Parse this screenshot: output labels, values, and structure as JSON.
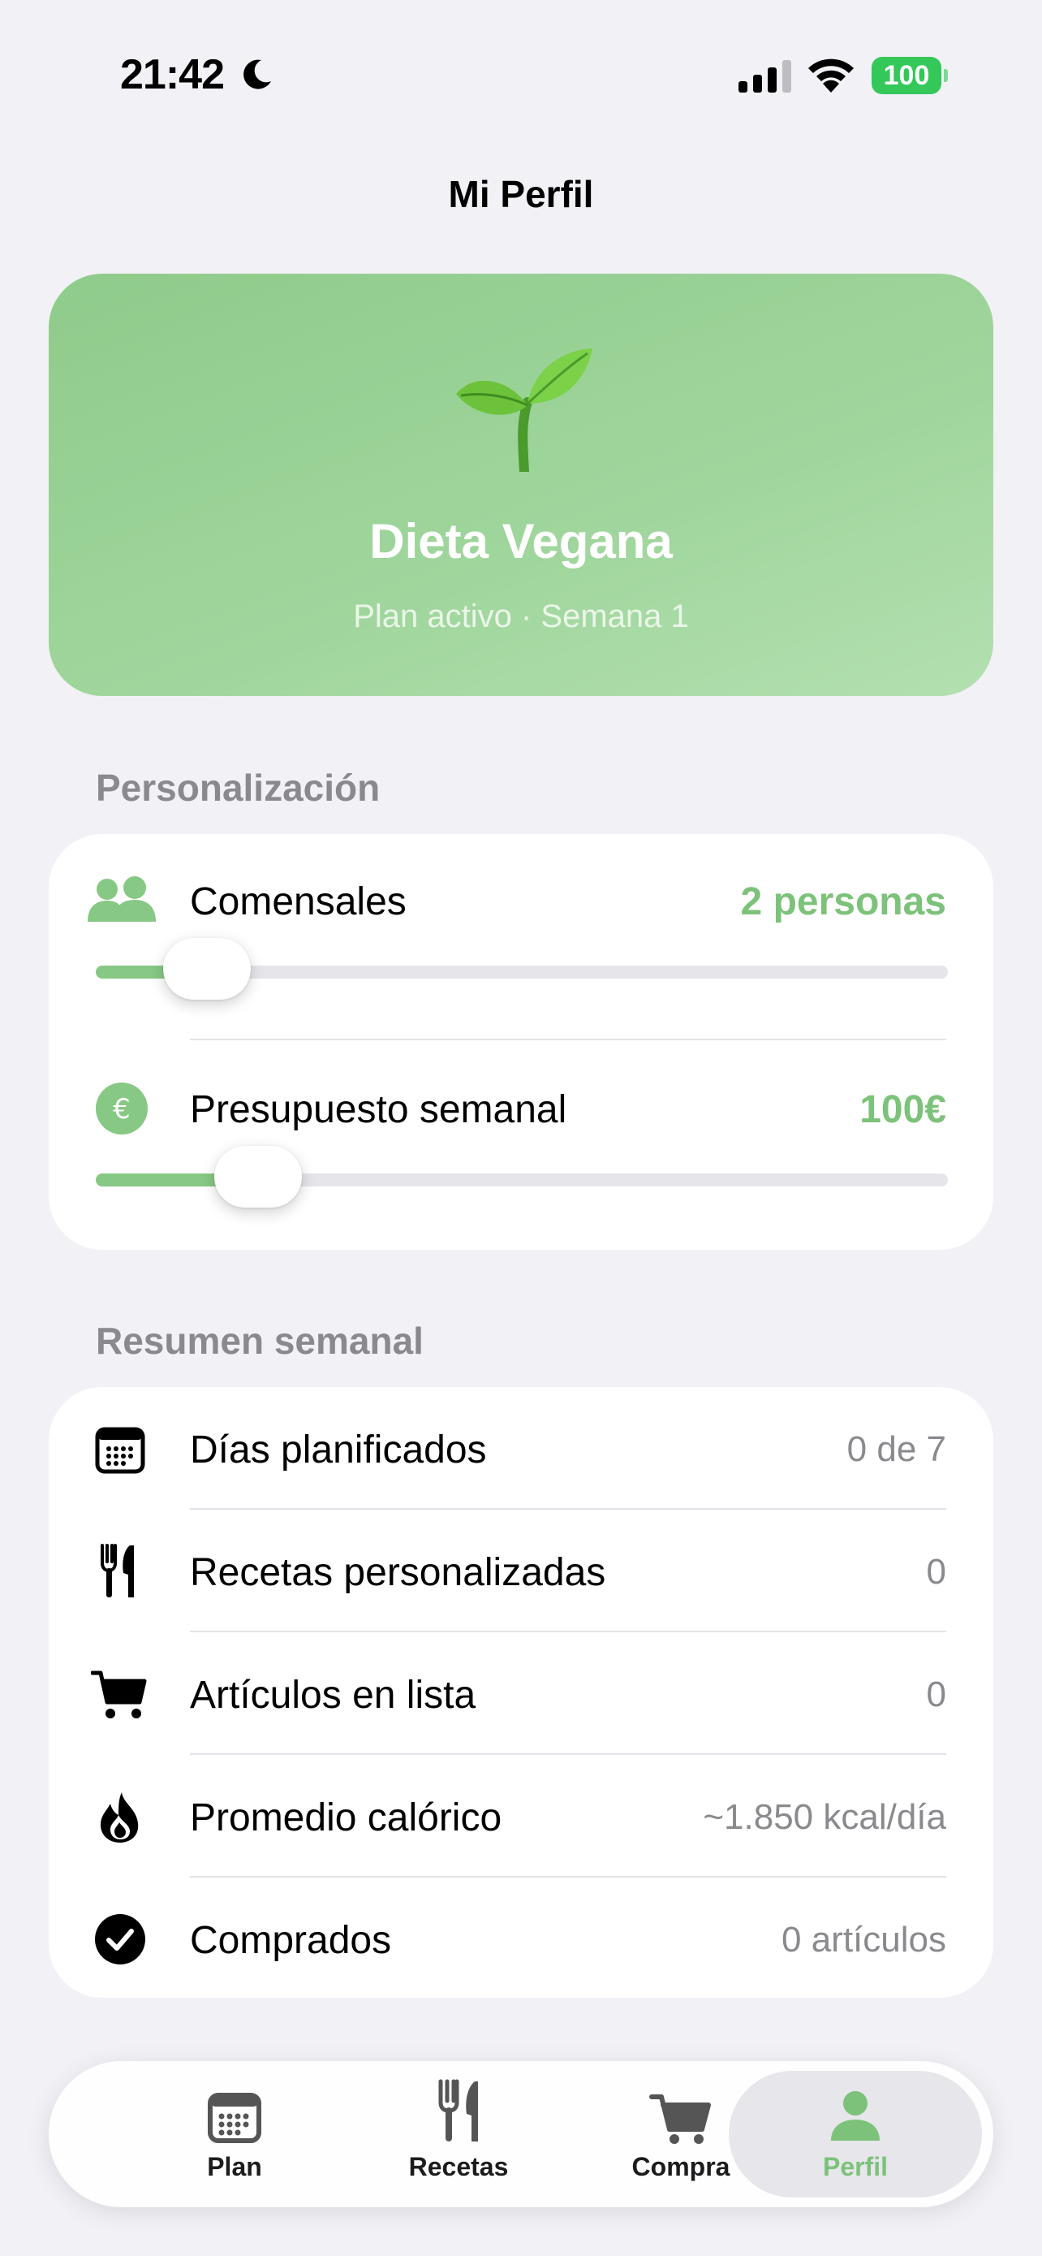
{
  "status_bar": {
    "time": "21:42",
    "battery": "100"
  },
  "page": {
    "title": "Mi Perfil"
  },
  "hero": {
    "title": "Dieta Vegana",
    "subtitle": "Plan activo · Semana 1",
    "icon": "sprout-icon"
  },
  "personalization": {
    "section_label": "Personalización",
    "diners": {
      "label": "Comensales",
      "value": "2 personas",
      "slider_fraction": 0.13,
      "icon": "people-icon"
    },
    "budget": {
      "label": "Presupuesto semanal",
      "value": "100€",
      "slider_fraction": 0.19,
      "icon": "euro-icon"
    }
  },
  "summary": {
    "section_label": "Resumen semanal",
    "rows": [
      {
        "label": "Días planificados",
        "value": "0 de 7",
        "icon": "calendar-icon"
      },
      {
        "label": "Recetas personalizadas",
        "value": "0",
        "icon": "fork-knife-icon"
      },
      {
        "label": "Artículos en lista",
        "value": "0",
        "icon": "cart-icon"
      },
      {
        "label": "Promedio calórico",
        "value": "~1.850 kcal/día",
        "icon": "flame-icon"
      },
      {
        "label": "Comprados",
        "value": "0 artículos",
        "icon": "checkmark-circle-icon"
      }
    ]
  },
  "tabbar": {
    "tabs": [
      {
        "label": "Plan",
        "icon": "calendar-icon"
      },
      {
        "label": "Recetas",
        "icon": "fork-knife-icon"
      },
      {
        "label": "Compra",
        "icon": "cart-icon"
      },
      {
        "label": "Perfil",
        "icon": "person-icon",
        "active": true
      }
    ]
  },
  "colors": {
    "accent_green": "#7cc27a",
    "hero_green": "#9ad397",
    "background": "#f2f1f6"
  }
}
